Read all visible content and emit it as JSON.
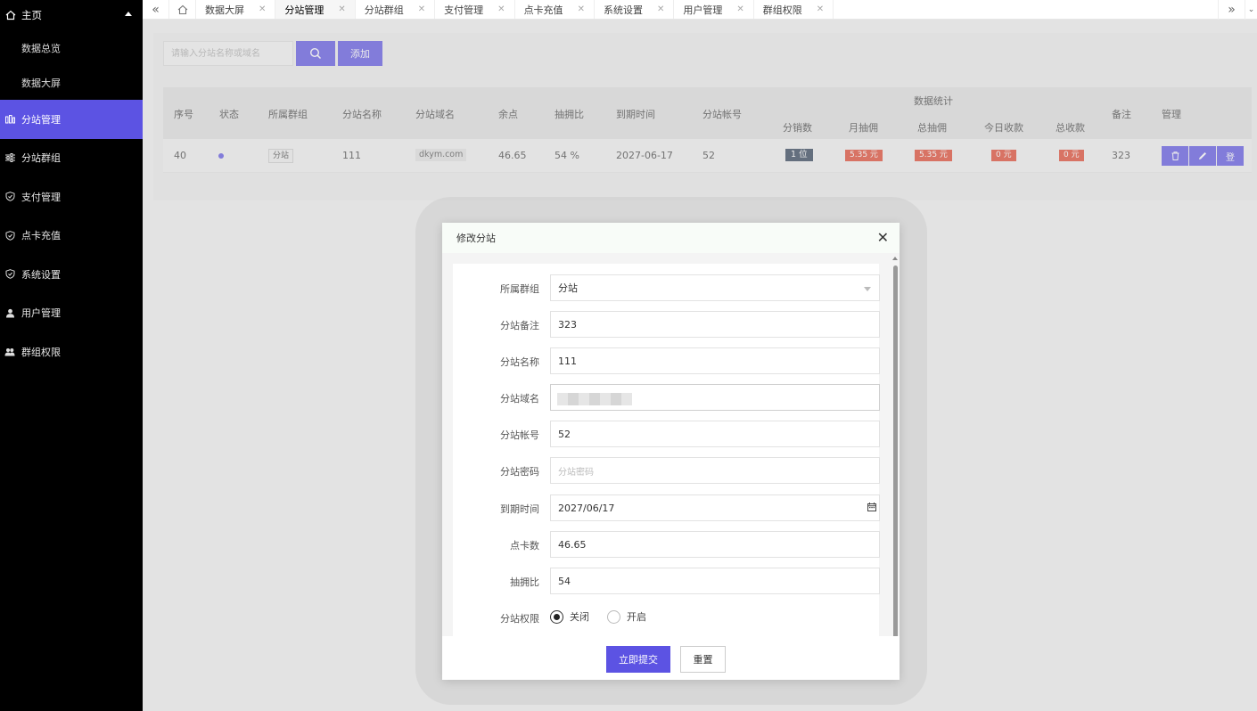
{
  "sidebar": {
    "home": "主页",
    "sub_items": [
      "数据总览",
      "数据大屏"
    ],
    "items": [
      {
        "label": "分站管理",
        "icon": "bar-chart-icon",
        "active": true
      },
      {
        "label": "分站群组",
        "icon": "sliders-icon"
      },
      {
        "label": "支付管理",
        "icon": "shield-check-icon"
      },
      {
        "label": "点卡充值",
        "icon": "shield-check-icon"
      },
      {
        "label": "系统设置",
        "icon": "shield-check-icon"
      },
      {
        "label": "用户管理",
        "icon": "user-icon"
      },
      {
        "label": "群组权限",
        "icon": "users-icon"
      }
    ]
  },
  "tabs": [
    {
      "label": "数据大屏"
    },
    {
      "label": "分站管理",
      "active": true
    },
    {
      "label": "分站群组"
    },
    {
      "label": "支付管理"
    },
    {
      "label": "点卡充值"
    },
    {
      "label": "系统设置"
    },
    {
      "label": "用户管理"
    },
    {
      "label": "群组权限"
    }
  ],
  "toolbar": {
    "search_placeholder": "请输入分站名称或域名",
    "add_label": "添加"
  },
  "table": {
    "headers": {
      "id": "序号",
      "status": "状态",
      "group": "所属群组",
      "name": "分站名称",
      "domain": "分站域名",
      "balance": "余点",
      "commission_ratio": "抽拥比",
      "expire": "到期时间",
      "account": "分站帐号",
      "stats": "数据统计",
      "distributors": "分销数",
      "monthly_commission": "月抽佣",
      "total_commission": "总抽佣",
      "today_income": "今日收款",
      "total_income": "总收款",
      "remark": "备注",
      "manage": "管理"
    },
    "row": {
      "id": "40",
      "group": "分站",
      "name": "111",
      "domain": "dkym.com",
      "balance": "46.65",
      "commission_ratio": "54 %",
      "expire": "2027-06-17",
      "account": "52",
      "distributors": "1 位",
      "monthly_commission": "5.35 元",
      "total_commission": "5.35 元",
      "today_income": "0 元",
      "total_income": "0 元",
      "remark": "323",
      "login_label": "登"
    }
  },
  "modal": {
    "title": "修改分站",
    "fields": {
      "group": {
        "label": "所属群组",
        "value": "分站"
      },
      "remark": {
        "label": "分站备注",
        "value": "323"
      },
      "name": {
        "label": "分站名称",
        "value": "111"
      },
      "domain": {
        "label": "分站域名"
      },
      "account": {
        "label": "分站帐号",
        "value": "52"
      },
      "password": {
        "label": "分站密码",
        "placeholder": "分站密码"
      },
      "expire": {
        "label": "到期时间",
        "value": "2027/06/17"
      },
      "points": {
        "label": "点卡数",
        "value": "46.65"
      },
      "ratio": {
        "label": "抽拥比",
        "value": "54"
      },
      "permission": {
        "label": "分站权限",
        "options": [
          "关闭",
          "开启"
        ],
        "selected": "关闭"
      }
    },
    "submit_label": "立即提交",
    "reset_label": "重置"
  },
  "colors": {
    "accent": "#5c53e3",
    "sidebar_bg": "#000000",
    "badge_red": "#e0452e",
    "badge_dark": "#2f4056"
  }
}
